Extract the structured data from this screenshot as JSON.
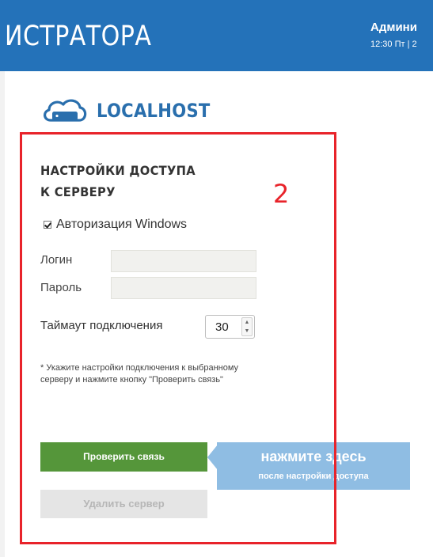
{
  "header": {
    "title": "ИСТРАТОРА",
    "user": "Админи",
    "datetime": "12:30 Пт | 2"
  },
  "server": {
    "name": "LOCALHOST",
    "icon": "cloud-server-icon"
  },
  "access_settings": {
    "title_line1": "НАСТРОЙКИ ДОСТУПА",
    "title_line2": "К СЕРВЕРУ",
    "windows_auth_label": "Авторизация Windows",
    "windows_auth_checked": true,
    "login_label": "Логин",
    "login_value": "",
    "password_label": "Пароль",
    "password_value": "",
    "timeout_label": "Таймаут подключения",
    "timeout_value": "30",
    "note": "* Укажите настройки подключения к выбранному серверу и нажмите кнопку \"Проверить связь\""
  },
  "buttons": {
    "check_connection": "Проверить связь",
    "delete_server": "Удалить сервер"
  },
  "hint": {
    "main": "нажмите здесь",
    "sub": "после настройки доступа"
  },
  "annotation": {
    "number": "2",
    "color": "#e8232a"
  },
  "colors": {
    "header_bg": "#2472b9",
    "primary_button": "#55963a",
    "hint_bg": "#8fbde3",
    "server_name": "#2a6fad"
  }
}
